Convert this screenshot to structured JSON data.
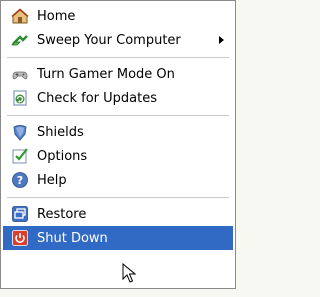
{
  "menu": {
    "items": [
      {
        "label": "Home",
        "icon": "home-icon"
      },
      {
        "label": "Sweep Your Computer",
        "icon": "sweep-icon"
      },
      {
        "label": "Turn Gamer Mode On",
        "icon": "gamepad-icon"
      },
      {
        "label": "Check for Updates",
        "icon": "update-icon"
      },
      {
        "label": "Shields",
        "icon": "shield-icon"
      },
      {
        "label": "Options",
        "icon": "options-icon"
      },
      {
        "label": "Help",
        "icon": "help-icon"
      },
      {
        "label": "Restore",
        "icon": "restore-icon"
      },
      {
        "label": "Shut Down",
        "icon": "shutdown-icon"
      }
    ],
    "selected": "Shut Down"
  },
  "colors": {
    "selection": "#316ac5",
    "menu_bg": "#ffffff",
    "separator": "#c9c9c9"
  }
}
